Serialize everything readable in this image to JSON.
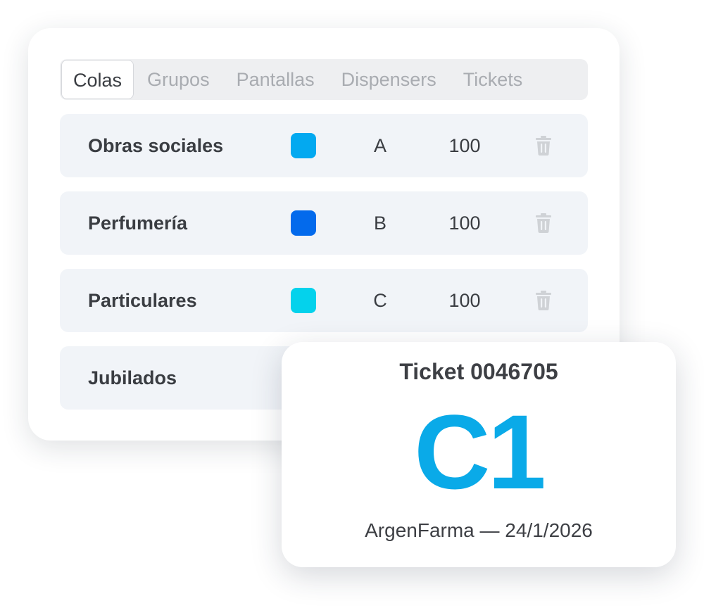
{
  "tabs": [
    {
      "label": "Colas",
      "active": true
    },
    {
      "label": "Grupos",
      "active": false
    },
    {
      "label": "Pantallas",
      "active": false
    },
    {
      "label": "Dispensers",
      "active": false
    },
    {
      "label": "Tickets",
      "active": false
    }
  ],
  "queues": [
    {
      "name": "Obras sociales",
      "color": "#03a9f0",
      "letter": "A",
      "count": "100",
      "icon": "trash-icon"
    },
    {
      "name": "Perfumería",
      "color": "#036aec",
      "letter": "B",
      "count": "100",
      "icon": "trash-icon"
    },
    {
      "name": "Particulares",
      "color": "#04d2ec",
      "letter": "C",
      "count": "100",
      "icon": "trash-icon"
    },
    {
      "name": "Jubilados",
      "color": "#c7eef0"
    }
  ],
  "ticket": {
    "title": "Ticket 0046705",
    "code": "C1",
    "footer": "ArgenFarma — 24/1/2026",
    "code_color": "#0aaae8"
  }
}
